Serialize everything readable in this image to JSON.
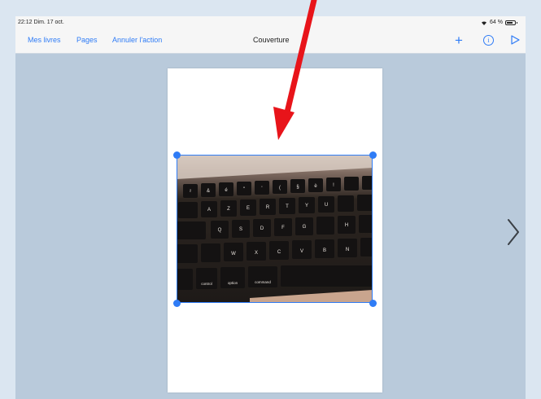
{
  "status_bar": {
    "time": "22:12  Dim. 17 oct.",
    "battery": "64 %",
    "icons": [
      "wifi-icon",
      "battery-icon"
    ]
  },
  "nav": {
    "left_links": [
      "Mes livres",
      "Pages",
      "Annuler l'action"
    ],
    "title": "Couverture",
    "right_icons": [
      "plus-icon",
      "info-icon",
      "play-icon"
    ]
  },
  "canvas": {
    "keyboard_keys_row1": [
      "²",
      "&",
      "é",
      "\"",
      "'",
      "(",
      "§",
      "è",
      "!"
    ],
    "keyboard_keys_row2": [
      "A",
      "Z",
      "E",
      "R",
      "T",
      "Y",
      "U"
    ],
    "keyboard_keys_row3": [
      "Q",
      "S",
      "D",
      "F",
      "G",
      "H"
    ],
    "keyboard_keys_row4": [
      "W",
      "X",
      "C",
      "V",
      "B",
      "N"
    ],
    "keyboard_keys_row5": [
      "control",
      "option",
      "command"
    ]
  },
  "colors": {
    "accent": "#2f7cf6",
    "annotation_arrow": "#e8141a",
    "background": "#b9cadb"
  }
}
